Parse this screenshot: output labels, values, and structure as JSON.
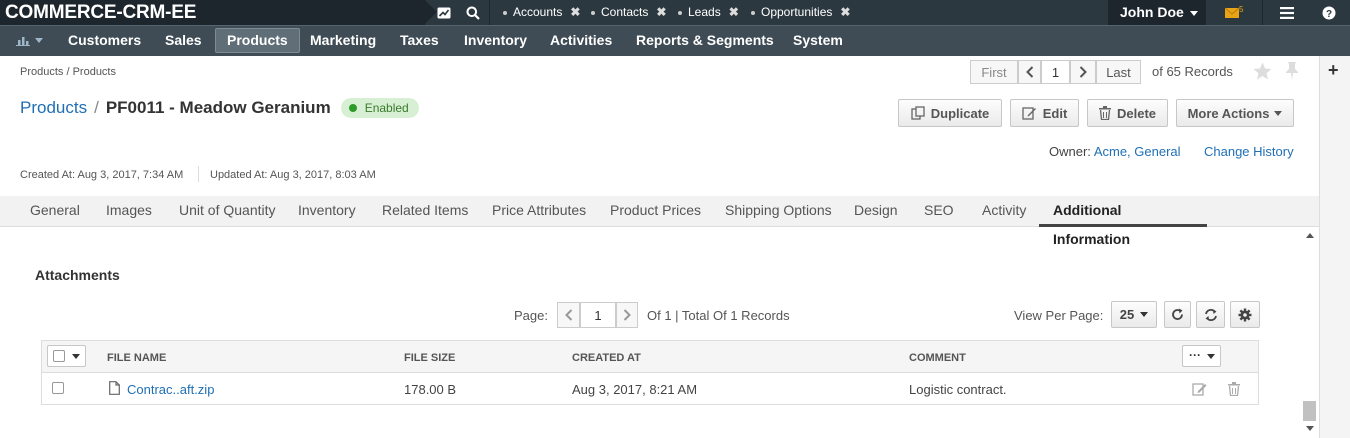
{
  "app": {
    "logo": "COMMERCE-CRM-EE"
  },
  "topbar": {
    "shortcuts": [
      {
        "label": "Accounts"
      },
      {
        "label": "Contacts"
      },
      {
        "label": "Leads"
      },
      {
        "label": "Opportunities"
      }
    ],
    "close_glyph": "✖",
    "user": "John Doe",
    "mail_count": "5"
  },
  "menu": {
    "items": [
      "Customers",
      "Sales",
      "Products",
      "Marketing",
      "Taxes",
      "Inventory",
      "Activities",
      "Reports & Segments",
      "System"
    ],
    "active": "Products"
  },
  "breadcrumb": "Products / Products",
  "pager_top": {
    "first": "First",
    "page": "1",
    "last": "Last",
    "of_records": "of 65 Records"
  },
  "entity": {
    "section_link": "Products",
    "separator": "/",
    "title": "PF0011 - Meadow Geranium",
    "status": "Enabled",
    "owner_label": "Owner:",
    "owner": "Acme, General",
    "change_history": "Change History",
    "created_at": "Created At: Aug 3, 2017, 7:34 AM",
    "updated_at": "Updated At: Aug 3, 2017, 8:03 AM"
  },
  "actions": {
    "duplicate": "Duplicate",
    "edit": "Edit",
    "delete": "Delete",
    "more": "More Actions"
  },
  "tabs": [
    "General",
    "Images",
    "Unit of Quantity",
    "Inventory",
    "Related Items",
    "Price Attributes",
    "Product Prices",
    "Shipping Options",
    "Design",
    "SEO",
    "Activity",
    "Additional Information"
  ],
  "active_tab": "Additional Information",
  "attachments": {
    "title": "Attachments",
    "page_label": "Page:",
    "page": "1",
    "info": "Of 1 | Total Of 1 Records",
    "view_per_page_label": "View Per Page:",
    "view_per_page": "25",
    "columns": [
      "FILE NAME",
      "FILE SIZE",
      "CREATED AT",
      "COMMENT"
    ],
    "col_menu": "···",
    "rows": [
      {
        "file_name": "Contrac..aft.zip",
        "file_size": "178.00 B",
        "created_at": "Aug 3, 2017, 8:21 AM",
        "comment": "Logistic contract."
      }
    ]
  },
  "rail": {
    "add": "+"
  },
  "colors": {
    "topbar": "#2c3840",
    "menu": "#3f4c55",
    "link": "#1f6fb5",
    "badge_bg": "#d7f0d4",
    "badge_dot": "#2e9b29"
  }
}
